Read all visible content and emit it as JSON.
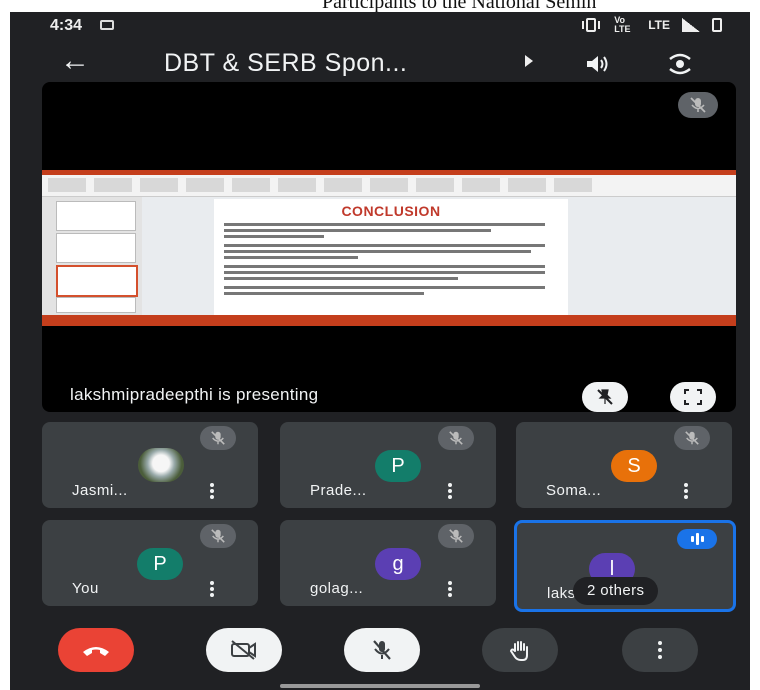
{
  "document_caption": "Participants to the National Semin",
  "status_bar": {
    "time": "4:34",
    "volte_label": "Vo LTE",
    "lte_label": "LTE"
  },
  "app_bar": {
    "title": "DBT & SERB Spon..."
  },
  "presentation": {
    "presenter_text": "lakshmipradeepthi is presenting",
    "slide": {
      "heading": "CONCLUSION"
    }
  },
  "participants": [
    {
      "name": "Jasmi...",
      "initial": "",
      "avatar_color": "#3c4043",
      "photo": true,
      "muted": true
    },
    {
      "name": "Prade...",
      "initial": "P",
      "avatar_color": "#137d6a",
      "photo": false,
      "muted": true
    },
    {
      "name": "Soma...",
      "initial": "S",
      "avatar_color": "#e8710a",
      "photo": false,
      "muted": true
    },
    {
      "name": "You",
      "initial": "P",
      "avatar_color": "#137d6a",
      "photo": false,
      "muted": true
    },
    {
      "name": "golag...",
      "initial": "g",
      "avatar_color": "#5b3fb3",
      "photo": false,
      "muted": true
    },
    {
      "name": "laksh...",
      "initial": "l",
      "avatar_color": "#5b3fb3",
      "photo": false,
      "muted": false,
      "speaking": true,
      "others_label": "2 others"
    }
  ],
  "colors": {
    "end_call": "#ea4335",
    "speaking_accent": "#1a73e8",
    "background": "#202124"
  }
}
